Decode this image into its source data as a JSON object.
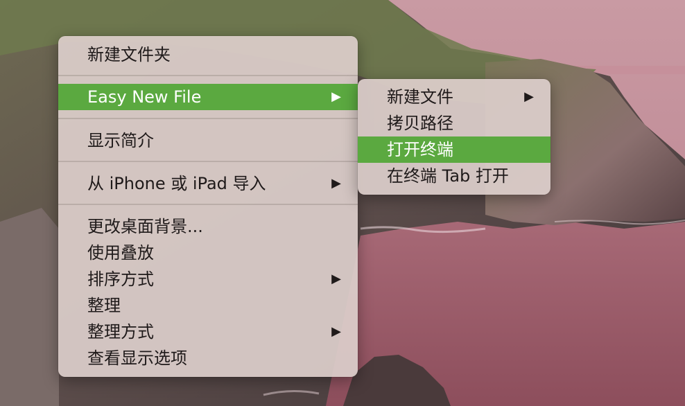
{
  "main_menu": {
    "items": [
      {
        "label": "新建文件夹"
      },
      {
        "label": "Easy New File",
        "arrow": "▶"
      },
      {
        "label": "显示简介"
      },
      {
        "label": "从 iPhone 或 iPad 导入",
        "arrow": "▶"
      },
      {
        "label": "更改桌面背景..."
      },
      {
        "label": "使用叠放"
      },
      {
        "label": "排序方式",
        "arrow": "▶"
      },
      {
        "label": "整理"
      },
      {
        "label": "整理方式",
        "arrow": "▶"
      },
      {
        "label": "查看显示选项"
      }
    ]
  },
  "sub_menu": {
    "items": [
      {
        "label": "新建文件",
        "arrow": "▶"
      },
      {
        "label": "拷贝路径"
      },
      {
        "label": "打开终端"
      },
      {
        "label": "在终端 Tab 打开"
      }
    ]
  },
  "colors": {
    "highlight": "#5ba940",
    "menu_bg": "#dccec9"
  },
  "icons": {
    "submenu_arrow": "triangle-right-icon"
  }
}
